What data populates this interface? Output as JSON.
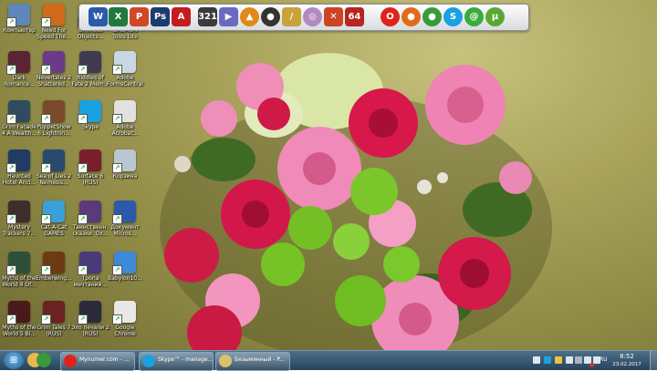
{
  "desktop": {
    "icons": [
      {
        "label": "Компьютер",
        "icon": "computer-icon",
        "color": "#5d87b8"
      },
      {
        "label": "Need For Speed The...",
        "icon": "nfs-game-icon",
        "color": "#d06a1c"
      },
      {
        "label": "Ominous Objects...",
        "icon": "game-icon",
        "color": "#6b5c8a"
      },
      {
        "label": "DAEMON Tools Lite",
        "icon": "daemon-tools-icon",
        "color": "#cf2b2b"
      },
      {
        "label": "Dark Romance...",
        "icon": "game-icon",
        "color": "#5b2436"
      },
      {
        "label": "Nevertales 2 Shattered...",
        "icon": "game-icon",
        "color": "#6d3a8a"
      },
      {
        "label": "Riddles of Fate 2 Mem...",
        "icon": "game-icon",
        "color": "#403a50"
      },
      {
        "label": "Adobe FormsCentral",
        "icon": "adobe-forms-icon",
        "color": "#c9d7e4"
      },
      {
        "label": "Grim Facade 4 A Wealth...",
        "icon": "game-icon",
        "color": "#2e4c5e"
      },
      {
        "label": "PuppetShow 6 Lightnin...",
        "icon": "game-icon",
        "color": "#7c4a2a"
      },
      {
        "label": "Skype",
        "icon": "skype-icon",
        "color": "#1aa1e0"
      },
      {
        "label": "Adobe Acrobat...",
        "icon": "acrobat-icon",
        "color": "#e1e1e1"
      },
      {
        "label": "Haunted Hotel Anci...",
        "icon": "game-icon",
        "color": "#1e3c66"
      },
      {
        "label": "Sea of Lies 2 Nemesis...",
        "icon": "game-icon",
        "color": "#284a6e"
      },
      {
        "label": "Surface 6 (RUS)",
        "icon": "game-icon",
        "color": "#7a1e2a"
      },
      {
        "label": "Корзина",
        "icon": "recycle-bin-icon",
        "color": "#b9c6d4"
      },
      {
        "label": "Mystery Trackers 7...",
        "icon": "game-icon",
        "color": "#3d2d2d"
      },
      {
        "label": "Cat-A-Cat GAMES",
        "icon": "game-icon",
        "color": "#3aa0d8"
      },
      {
        "label": "Таинственн. сказки. Ох...",
        "icon": "game-icon",
        "color": "#5a3a78"
      },
      {
        "label": "Документ Micros...",
        "icon": "word-document-icon",
        "color": "#2b5aa8"
      },
      {
        "label": "Myths of the World 4 Of...",
        "icon": "game-icon",
        "color": "#2e5038"
      },
      {
        "label": "Emberwing...",
        "icon": "game-icon",
        "color": "#6e3a12"
      },
      {
        "label": "Тропа мечтаний...",
        "icon": "game-icon",
        "color": "#4a3a7a"
      },
      {
        "label": "Babylon10...",
        "icon": "babylon-icon",
        "color": "#3c8ad8"
      },
      {
        "label": "Myths of the World 5 Bl...",
        "icon": "game-icon",
        "color": "#4a1a1a"
      },
      {
        "label": "Grim Tales 7 (RUS)",
        "icon": "game-icon",
        "color": "#6a2222"
      },
      {
        "label": "Эхо печали 2 (RUS)",
        "icon": "game-icon",
        "color": "#2a2a3a"
      },
      {
        "label": "Google Chrome",
        "icon": "chrome-icon",
        "color": "#e8e8e8"
      }
    ]
  },
  "dock": {
    "items": [
      {
        "name": "word-icon",
        "glyph": "W",
        "color": "#2b5aa8"
      },
      {
        "name": "excel-icon",
        "glyph": "X",
        "color": "#1f7a3d"
      },
      {
        "name": "powerpoint-icon",
        "glyph": "P",
        "color": "#d24726"
      },
      {
        "name": "photoshop-icon",
        "glyph": "Ps",
        "color": "#1d3c6e"
      },
      {
        "name": "acrobat-icon",
        "glyph": "A",
        "color": "#c41d1d"
      },
      {
        "name": "media-player-classic-icon",
        "glyph": "321",
        "color": "#3b3b3b"
      },
      {
        "name": "virtualdub-icon",
        "glyph": "▶",
        "color": "#6a6ac0"
      },
      {
        "name": "aimp-icon",
        "glyph": "▲",
        "color": "#e08a1a"
      },
      {
        "name": "webcam-icon",
        "glyph": "●",
        "color": "#333333"
      },
      {
        "name": "pen-icon",
        "glyph": "/",
        "color": "#c9a23a"
      },
      {
        "name": "cd-burner-icon",
        "glyph": "◎",
        "color": "#b08ac0"
      },
      {
        "name": "tools-icon",
        "glyph": "✕",
        "color": "#cc4422"
      },
      {
        "name": "sixty-four-icon",
        "glyph": "64",
        "color": "#b8241e"
      },
      {
        "name": "opera-icon",
        "glyph": "O",
        "color": "#e0231b"
      },
      {
        "name": "firefox-icon",
        "glyph": "●",
        "color": "#e36a1a"
      },
      {
        "name": "chrome-icon",
        "glyph": "●",
        "color": "#3a9a3a"
      },
      {
        "name": "skype-icon",
        "glyph": "S",
        "color": "#1aa1e0"
      },
      {
        "name": "icq-icon",
        "glyph": "@",
        "color": "#3aac3a"
      },
      {
        "name": "utorrent-icon",
        "glyph": "µ",
        "color": "#5aa832"
      }
    ]
  },
  "taskbar": {
    "start_glyph": "⊞",
    "pinned": [
      {
        "name": "explorer-pin-icon",
        "color": "#e8b84a"
      },
      {
        "name": "chrome-pin-icon",
        "color": "#3a9a3a"
      }
    ],
    "buttons": [
      {
        "name": "opera-task-button",
        "title": "Mynumer.com - ...",
        "color": "#e0231b"
      },
      {
        "name": "skype-task-button",
        "title": "Skype™ - manage...",
        "color": "#1aa1e0"
      },
      {
        "name": "paint-task-button",
        "title": "Безымянный - P...",
        "color": "#d9c36a"
      }
    ],
    "tray": [
      {
        "name": "keyboard-tray-icon",
        "color": "#dfe6ee"
      },
      {
        "name": "skype-tray-icon",
        "color": "#1aa1e0"
      },
      {
        "name": "folder-tray-icon",
        "color": "#e8c24a"
      },
      {
        "name": "network-tray-icon",
        "color": "#dfe6ee"
      },
      {
        "name": "webcam-tray-icon",
        "color": "#aab6c2"
      },
      {
        "name": "flag-tray-icon",
        "color": "#dfe6ee"
      },
      {
        "name": "volume-tray-icon",
        "color": "#dfe6ee"
      },
      {
        "name": "antivirus-tray-icon",
        "color": "#d8342a"
      }
    ],
    "language": "RU",
    "clock_time": "8:52",
    "clock_date": "23.02.2017"
  }
}
